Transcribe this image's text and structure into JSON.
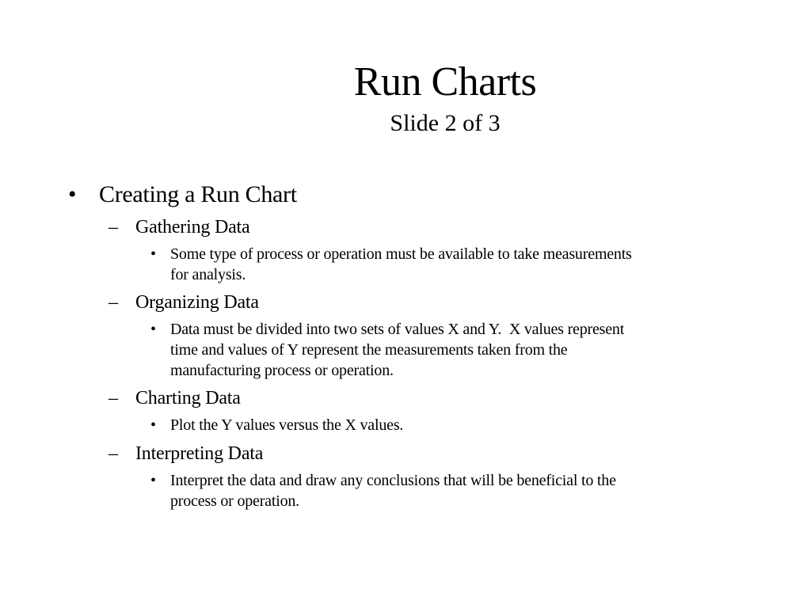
{
  "slide": {
    "title": "Run Charts",
    "subtitle": "Slide 2 of 3",
    "bullet": {
      "marker": "•",
      "text": "Creating a Run Chart"
    },
    "sections": [
      {
        "marker": "–",
        "heading": "Gathering Data",
        "detail_marker": "•",
        "detail_lines": [
          "Some type of process or operation must be available to take measurements",
          "for analysis."
        ]
      },
      {
        "marker": "–",
        "heading": "Organizing Data",
        "detail_marker": "•",
        "detail_lines": [
          "Data must be divided into two sets of values X and Y.  X values represent",
          "time and values of Y represent the measurements taken from the",
          "manufacturing process or operation."
        ]
      },
      {
        "marker": "–",
        "heading": "Charting Data",
        "detail_marker": "•",
        "detail_lines": [
          "Plot the Y values versus the X values."
        ]
      },
      {
        "marker": "–",
        "heading": "Interpreting Data",
        "detail_marker": "•",
        "detail_lines": [
          "Interpret the data and draw any conclusions that will be beneficial to the",
          "process or operation."
        ]
      }
    ]
  }
}
